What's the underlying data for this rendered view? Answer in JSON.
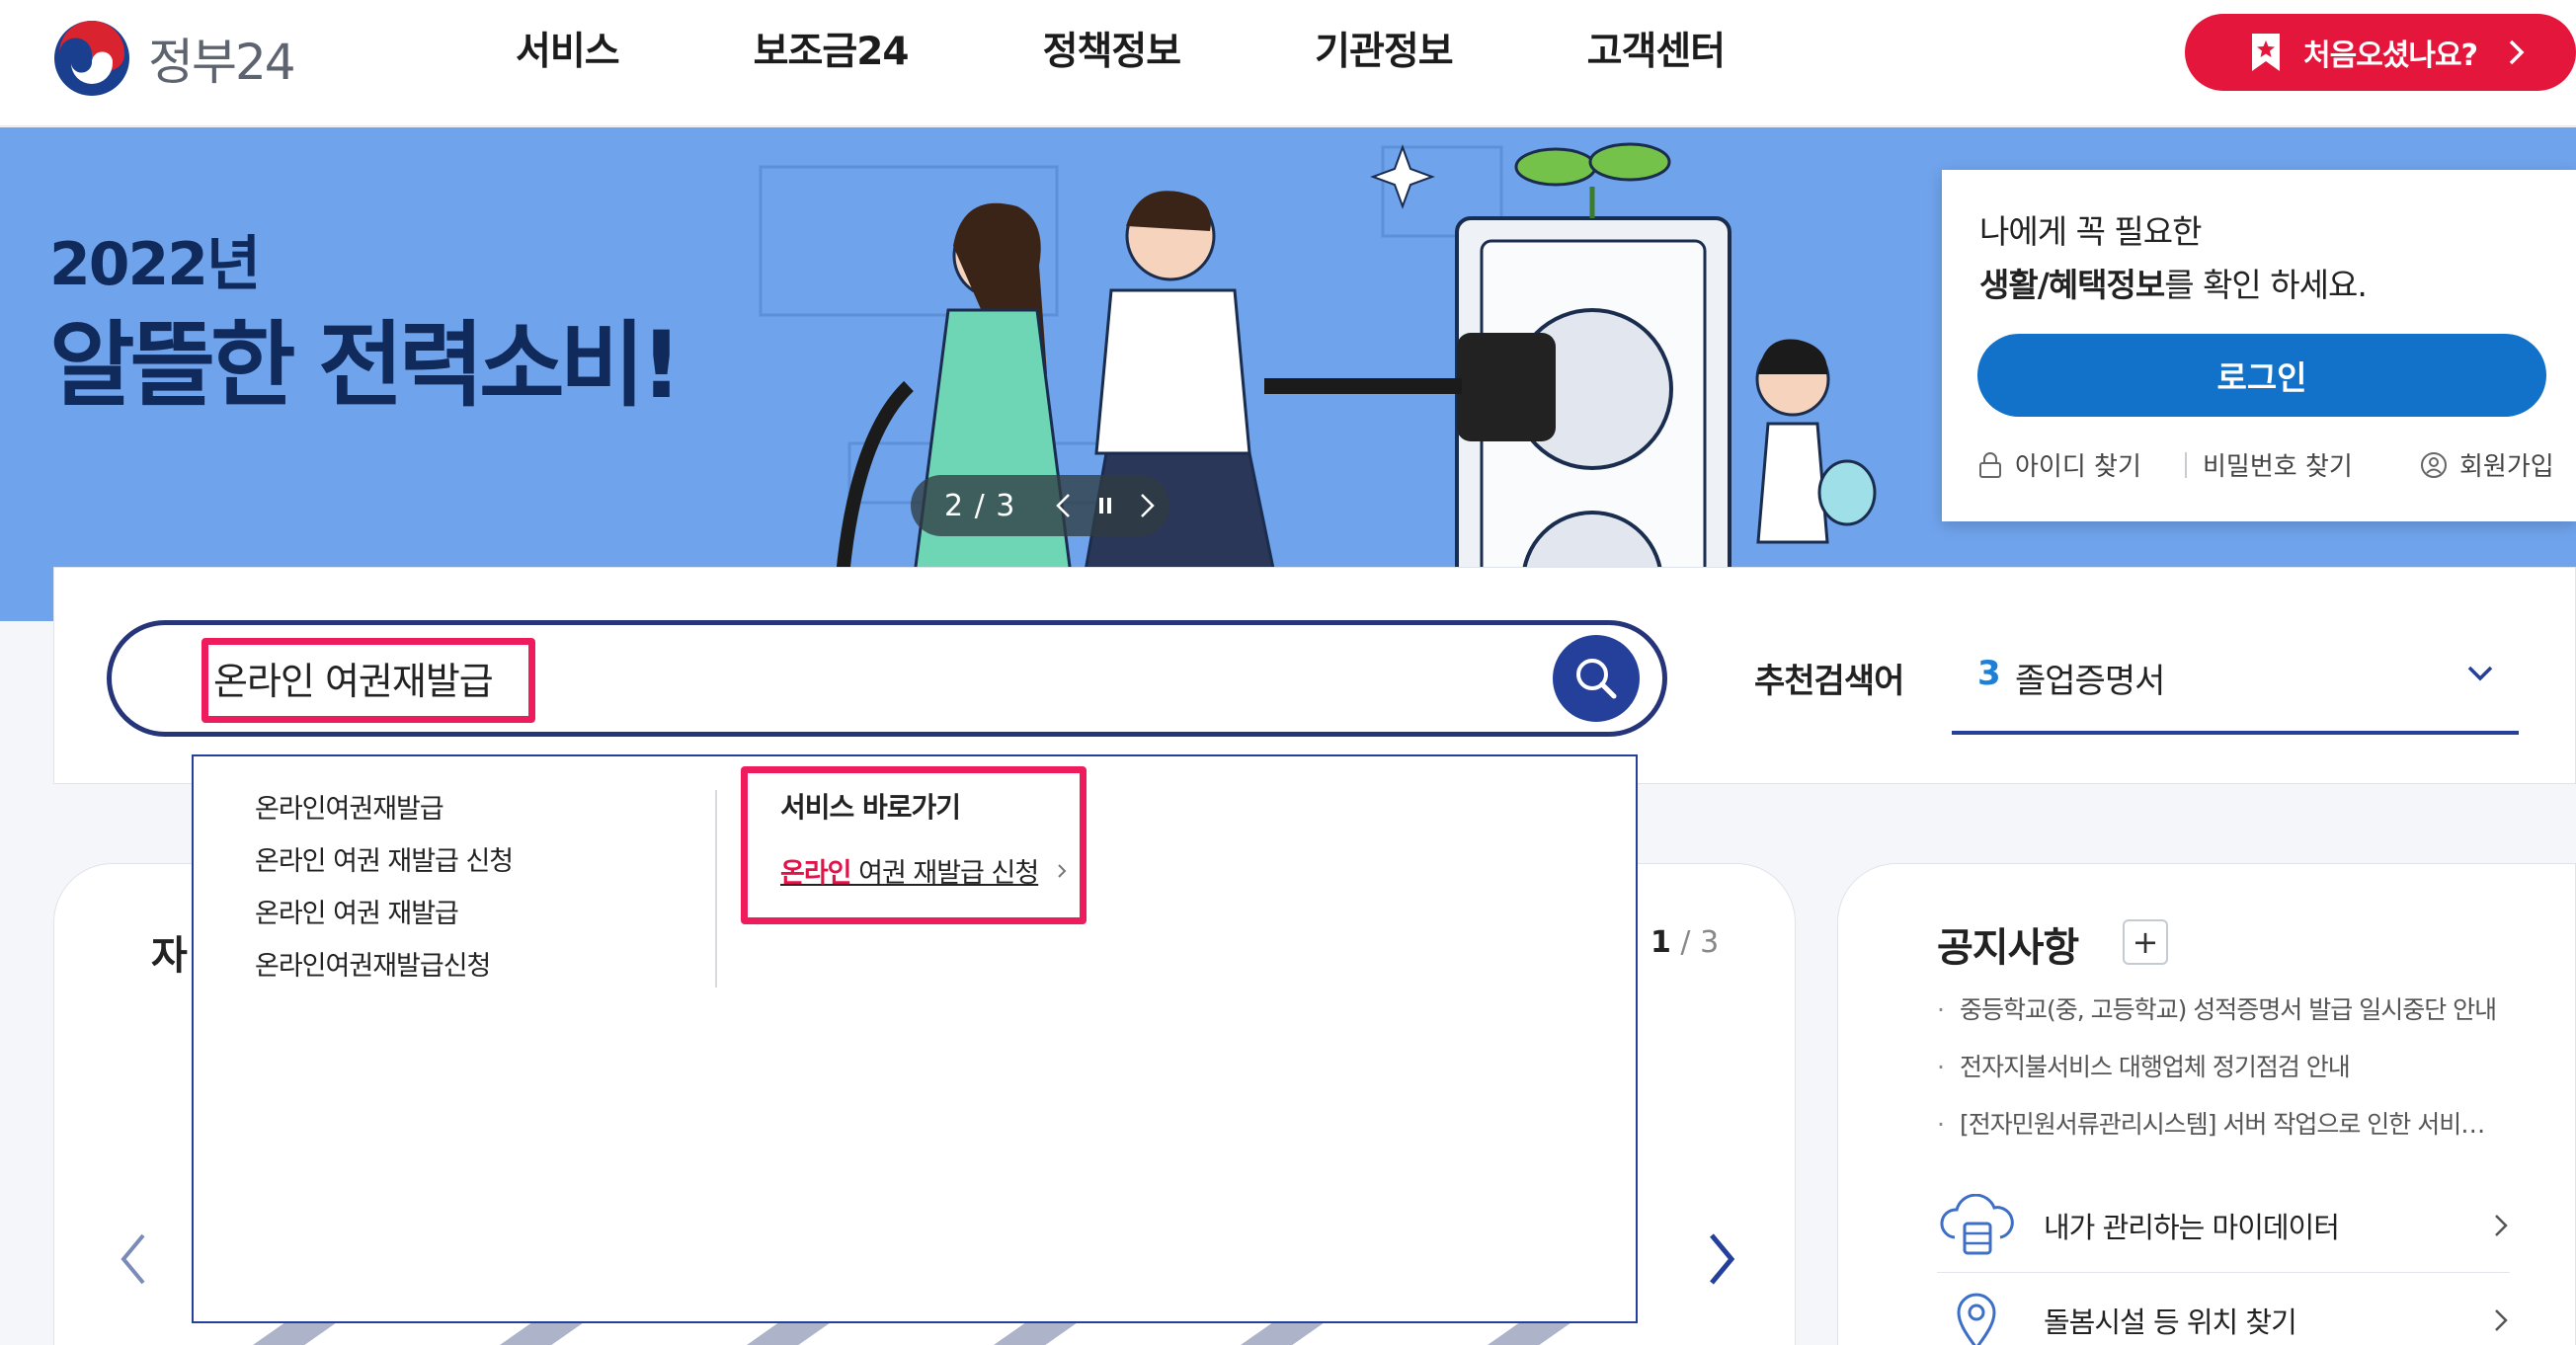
{
  "header": {
    "logo_text": "정부24",
    "nav": [
      "서비스",
      "보조금24",
      "정책정보",
      "기관정보",
      "고객센터"
    ],
    "first_visit_label": "처음오셨나요?"
  },
  "banner": {
    "year": "2022년",
    "title": "알뜰한 전력소비!",
    "slide_counter": "2 / 3"
  },
  "login": {
    "line1": "나에게 꼭 필요한",
    "line2_bold": "생활/혜택정보",
    "line2_rest": "를 확인 하세요.",
    "button": "로그인",
    "find_id": "아이디 찾기",
    "find_pw": "비밀번호 찾기",
    "signup": "회원가입"
  },
  "search": {
    "value": "온라인 여권재발급",
    "reco_label": "추천검색어",
    "reco_rank": "3",
    "reco_text": "졸업증명서"
  },
  "autocomplete": {
    "suggestions": [
      "온라인여권재발급",
      "온라인 여권 재발급 신청",
      "온라인 여권 재발급",
      "온라인여권재발급신청"
    ],
    "service_title": "서비스 바로가기",
    "service_link_highlight": "온라인",
    "service_link_rest": " 여권 재발급 신청"
  },
  "main_card": {
    "title_partial": "자",
    "page_current": "1",
    "page_total": "/ 3"
  },
  "notice": {
    "title": "공지사항",
    "items": [
      "중등학교(중, 고등학교) 성적증명서 발급 일시중단 안내",
      "전자지불서비스 대행업체 정기점검 안내",
      "[전자민원서류관리시스템] 서버 작업으로 인한 서비…"
    ],
    "quick1": "내가 관리하는 마이데이터",
    "quick2": "돌봄시설 등 위치 찾기"
  },
  "colors": {
    "brand_red": "#e5163b",
    "search_navy": "#25409b",
    "login_blue": "#1271c9",
    "banner_blue": "#6fa3ec",
    "highlight_pink": "#ee1c5d"
  }
}
